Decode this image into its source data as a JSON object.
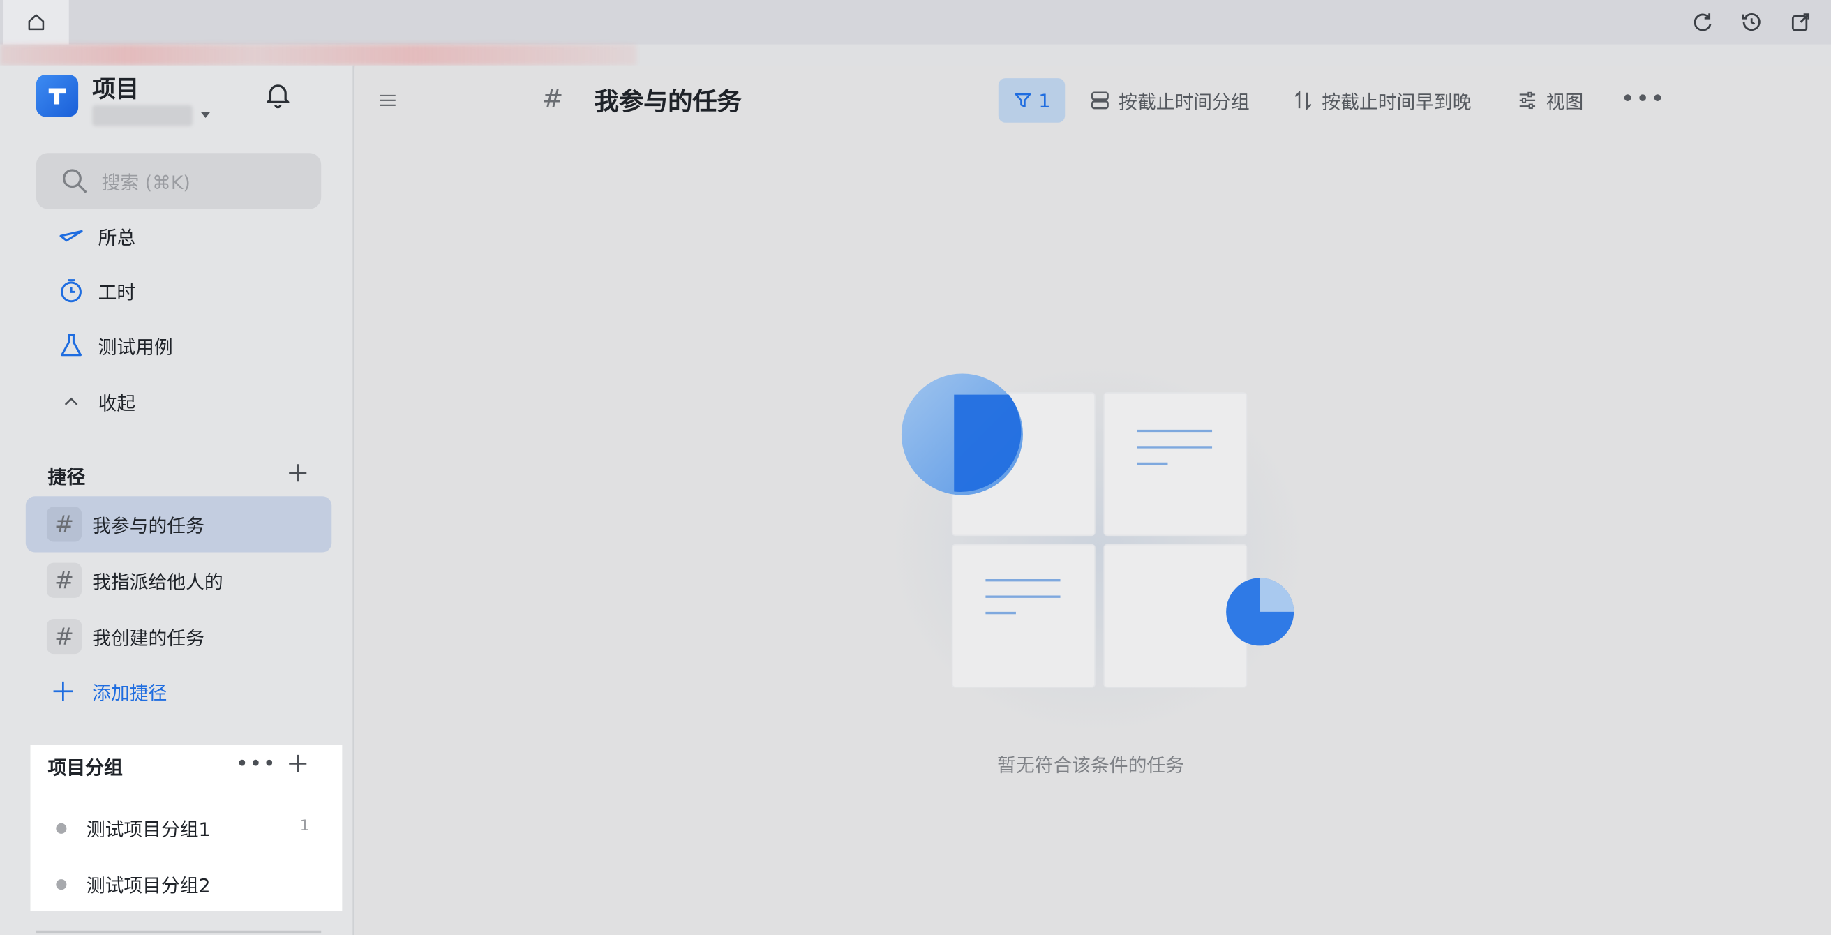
{
  "top_bar": {
    "home_icon": "home-icon",
    "icons": [
      "refresh-icon",
      "history-icon",
      "open-external-icon"
    ]
  },
  "sidebar": {
    "app_title": "项目",
    "search_placeholder": "搜索 (⌘K)",
    "nav_items": [
      {
        "label": "所总",
        "icon": "plane-icon"
      },
      {
        "label": "工时",
        "icon": "stopwatch-icon"
      },
      {
        "label": "测试用例",
        "icon": "flask-icon"
      },
      {
        "label": "收起",
        "icon": "chevron-up-icon"
      }
    ],
    "shortcuts": {
      "title": "捷径",
      "items": [
        {
          "label": "我参与的任务",
          "active": true
        },
        {
          "label": "我指派给他人的",
          "active": false
        },
        {
          "label": "我创建的任务",
          "active": false
        }
      ],
      "add_label": "添加捷径"
    },
    "project_groups": {
      "title": "项目分组",
      "items": [
        {
          "label": "测试项目分组1",
          "count": "1"
        },
        {
          "label": "测试项目分组2",
          "count": ""
        }
      ]
    }
  },
  "main": {
    "title_hash": "#",
    "title": "我参与的任务",
    "toolbar": {
      "filter_count": "1",
      "group_by": "按截止时间分组",
      "sort_by": "按截止时间早到晚",
      "view": "视图"
    },
    "empty_text": "暂无符合该条件的任务"
  },
  "colors": {
    "accent": "#1f6de0",
    "active_item_bg": "#c3cde0",
    "filter_bg": "#b9cee6"
  }
}
